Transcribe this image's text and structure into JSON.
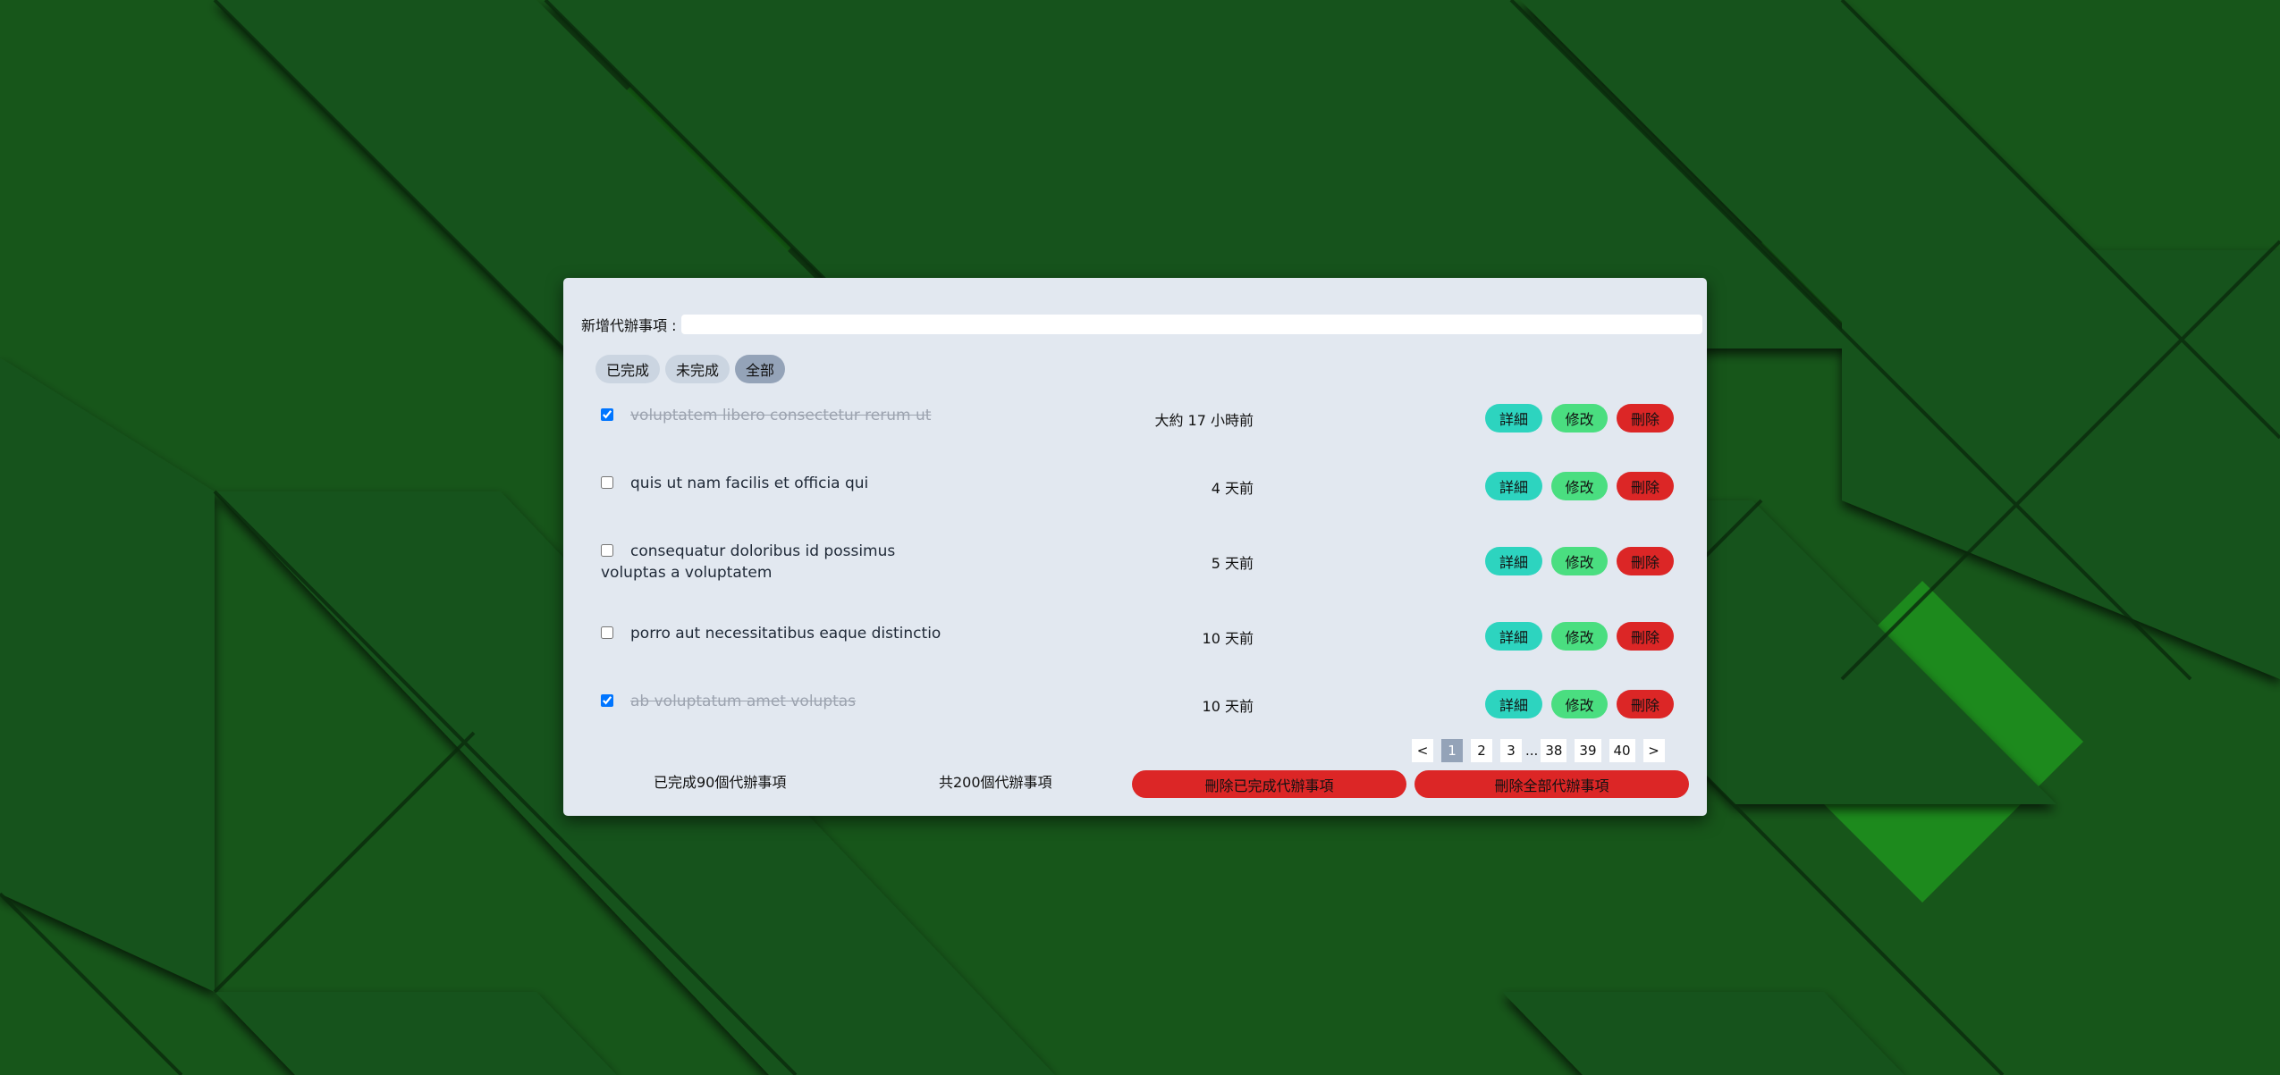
{
  "add": {
    "label": "新增代辦事項 :",
    "value": "",
    "placeholder": ""
  },
  "filters": [
    "已完成",
    "未完成",
    "全部"
  ],
  "active_filter": "全部",
  "todos": [
    {
      "text": "voluptatem libero consectetur rerum ut",
      "time": "大約 17 小時前",
      "done": true
    },
    {
      "text": "quis ut nam facilis et officia qui",
      "time": "4 天前",
      "done": false
    },
    {
      "text": "consequatur doloribus id possimus voluptas a voluptatem",
      "time": "5 天前",
      "done": false
    },
    {
      "text": "porro aut necessitatibus eaque distinctio",
      "time": "10 天前",
      "done": false
    },
    {
      "text": "ab voluptatum amet voluptas",
      "time": "10 天前",
      "done": true
    }
  ],
  "buttons": {
    "detail": "詳細",
    "edit": "修改",
    "delete": "刪除"
  },
  "pagination": {
    "prev": "<",
    "pages": [
      "1",
      "2",
      "3",
      "...",
      "38",
      "39",
      "40"
    ],
    "current": "1",
    "next": ">"
  },
  "footer": {
    "completed_count": "已完成90個代辦事項",
    "total_count": "共200個代辦事項",
    "delete_completed": "刪除已完成代辦事項",
    "delete_all": "刪除全部代辦事項"
  },
  "colors": {
    "background": "#17561a",
    "background_light": "#1d8a1d",
    "panel": "#e2e8f0",
    "detail": "#2dd4bf",
    "edit": "#4ade80",
    "delete": "#dc2626",
    "active_filter": "#94a3b8"
  }
}
